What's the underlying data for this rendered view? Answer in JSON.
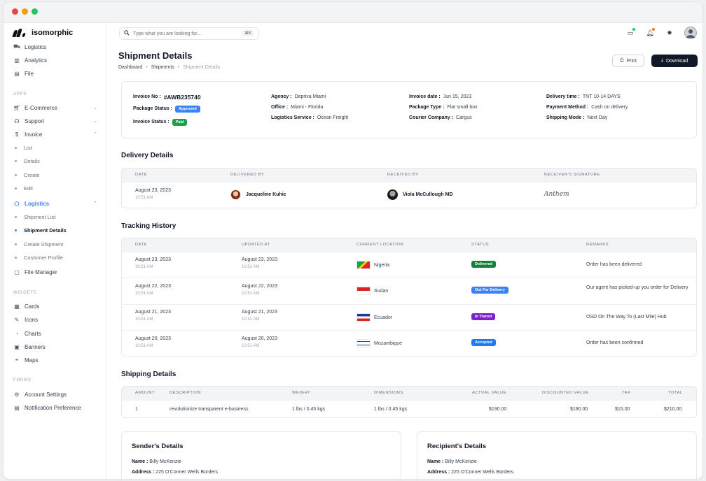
{
  "app": {
    "logo": "isomorphic"
  },
  "sidebar": {
    "top_items": [
      {
        "label": "Logistics",
        "icon": "truck-icon"
      },
      {
        "label": "Analytics",
        "icon": "chart-icon"
      },
      {
        "label": "File",
        "icon": "file-icon"
      }
    ],
    "apps_title": "APPS",
    "apps": [
      {
        "label": "E-Commerce",
        "icon": "cart-icon"
      },
      {
        "label": "Support",
        "icon": "headset-icon"
      },
      {
        "label": "Invoice",
        "icon": "dollar-icon"
      }
    ],
    "invoice_sub": [
      "List",
      "Details",
      "Create",
      "Edit"
    ],
    "logistics_label": "Logistics",
    "logistics_sub": [
      "Shipment List",
      "Shipment Details",
      "Create Shipment",
      "Customer Profile"
    ],
    "file_manager": "File Manager",
    "widgets_title": "WIDGETS",
    "widgets": [
      "Cards",
      "Icons",
      "Charts",
      "Banners",
      "Maps"
    ],
    "forms_title": "FORMS",
    "forms": [
      "Account Settings",
      "Notification Preference"
    ]
  },
  "search": {
    "placeholder": "Type what you are looking for...",
    "shortcut": "⌘K"
  },
  "header": {
    "title": "Shipment Details",
    "breadcrumb": [
      "Dashboard",
      "Shipments",
      "Shipment Details"
    ],
    "print_label": "Print",
    "download_label": "Download"
  },
  "invoice": {
    "no_label": "Invoice No :",
    "no_value": "#AWB235740",
    "package_status_label": "Package Status :",
    "package_status": "Approved",
    "invoice_status_label": "Invoice Status :",
    "invoice_status": "Paid",
    "agency_label": "Agency :",
    "agency": "Deprixa Miami",
    "office_label": "Office :",
    "office": "Miami - Florida",
    "service_label": "Logistics Service :",
    "service": "Ocean Freight",
    "date_label": "Invoice date :",
    "date": "Jun 15, 2023",
    "package_type_label": "Package Type :",
    "package_type": "Flat small box",
    "courier_label": "Courier Company :",
    "courier": "Cargus",
    "delivery_time_label": "Delivery time :",
    "delivery_time": "TNT 10-14 DAYS",
    "payment_label": "Payment Method :",
    "payment": "Cash on delivery",
    "mode_label": "Shipping Mode :",
    "mode": "Next Day"
  },
  "delivery": {
    "title": "Delivery Details",
    "headers": [
      "DATE",
      "DELIVERED BY",
      "RECEIVED BY",
      "RECEIVER'S SIGNATURE"
    ],
    "row": {
      "date": "August 23, 2023",
      "time": "10:51 AM",
      "delivered_by": "Jacqueline Kuhic",
      "received_by": "Viola McCullough MD",
      "signature": "Anthem"
    }
  },
  "tracking": {
    "title": "Tracking History",
    "headers": [
      "DATE",
      "UPDATED AT",
      "CURRENT LOCATION",
      "STATUS",
      "REMARKS"
    ],
    "rows": [
      {
        "date": "August 23, 2023",
        "time": "10:51 AM",
        "updated": "August 23, 2023",
        "utime": "10:51 AM",
        "location": "Nigeria",
        "status": "Delivered",
        "remark": "Order has been delivered"
      },
      {
        "date": "August 22, 2023",
        "time": "10:51 AM",
        "updated": "August 22, 2023",
        "utime": "10:51 AM",
        "location": "Sudan",
        "status": "Out For Delivery",
        "remark": "Our agent has picked-up you order for Delivery"
      },
      {
        "date": "August 21, 2023",
        "time": "10:51 AM",
        "updated": "August 21, 2023",
        "utime": "10:51 AM",
        "location": "Ecuador",
        "status": "In Transit",
        "remark": "OSD On The Way To (Last Mile) Hub"
      },
      {
        "date": "August 20, 2023",
        "time": "10:51 AM",
        "updated": "August 20, 2023",
        "utime": "10:51 AM",
        "location": "Mozambique",
        "status": "Accepted",
        "remark": "Order has been confirmed"
      }
    ]
  },
  "shipping": {
    "title": "Shipping Details",
    "headers": [
      "AMOUNT",
      "DESCRIPTION",
      "WEIGHT",
      "DIMENSIONS",
      "ACTUAL VALUE",
      "DISCOUNTED VALUE",
      "TAX",
      "TOTAL"
    ],
    "row": {
      "amount": "1",
      "description": "revolutionize transparent e-business",
      "weight": "1 lbs / 0.45 kgs",
      "dimensions": "1 lbs / 0.45 kgs",
      "actual": "$190.00",
      "discounted": "$190.00",
      "tax": "$15.00",
      "total": "$210.00"
    }
  },
  "sender": {
    "title": "Sender's Details",
    "name_label": "Name :",
    "name": "Billy McKenzie",
    "address_label": "Address :",
    "address": "225 O'Conner Wells Borders"
  },
  "recipient": {
    "title": "Recipient's Details",
    "name_label": "Name :",
    "name": "Billy McKenzie",
    "address_label": "Address :",
    "address": "225 O'Conner Wells Borders"
  },
  "colors": {
    "accent": "#3b82f6",
    "dark": "#111827",
    "delivered": "#15803d",
    "out_for_delivery": "#3b82f6",
    "in_transit": "#7e22ce",
    "accepted": "#1d7af0"
  }
}
